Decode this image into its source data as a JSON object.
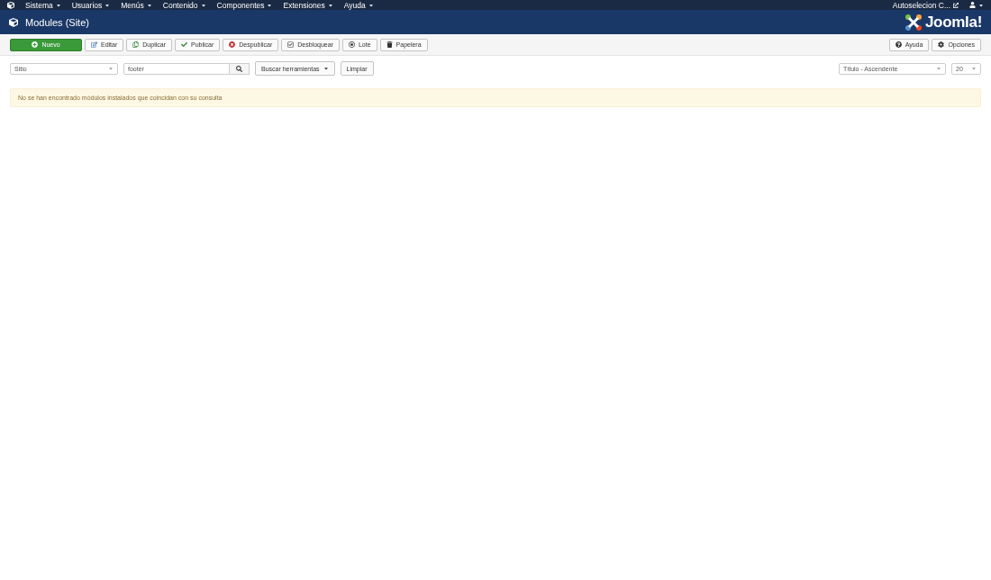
{
  "menu": [
    "Sistema",
    "Usuarios",
    "Menús",
    "Contenido",
    "Componentes",
    "Extensiones",
    "Ayuda"
  ],
  "site_link": "Autoselecion C...",
  "header": {
    "title": "Modules (Site)",
    "brand": "Joomla!"
  },
  "toolbar": [
    {
      "label": "Nuevo",
      "kind": "primary"
    },
    {
      "label": "Editar",
      "kind": "default"
    },
    {
      "label": "Duplicar",
      "kind": "default"
    },
    {
      "label": "Publicar",
      "kind": "default"
    },
    {
      "label": "Despublicar",
      "kind": "default"
    },
    {
      "label": "Desbloquear",
      "kind": "default"
    },
    {
      "label": "Lote",
      "kind": "default"
    },
    {
      "label": "Papelera",
      "kind": "default"
    }
  ],
  "toolbar_right": [
    "Ayuda",
    "Opciones"
  ],
  "filters": {
    "client": "Sitio",
    "search": "footer",
    "tools": "Buscar herramientas",
    "clear": "Limpiar",
    "ordering": "Título - Ascendente",
    "limit": "20"
  },
  "alert": "No se han encontrado módulos instalados que coincidan con su consulta"
}
